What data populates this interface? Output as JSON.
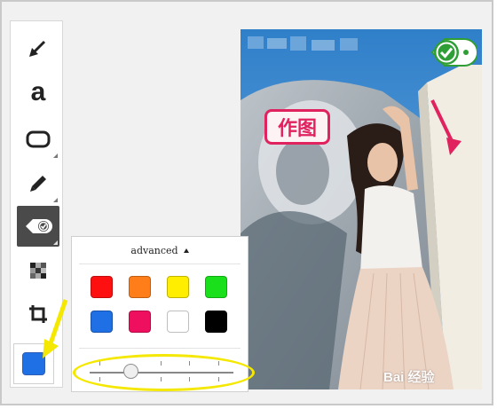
{
  "annotation_label": "作图",
  "watermark": "Bai 经验",
  "toolbar": {
    "tools": [
      {
        "name": "arrow-tool",
        "icon": "arrow-icon",
        "active": false
      },
      {
        "name": "text-tool",
        "icon": "text-a-icon",
        "glyph": "a",
        "active": false
      },
      {
        "name": "shape-tool",
        "icon": "rounded-rect-icon",
        "active": false
      },
      {
        "name": "pen-tool",
        "icon": "pen-icon",
        "active": false
      },
      {
        "name": "stamp-tool",
        "icon": "check-stamp-icon",
        "active": true
      },
      {
        "name": "mosaic-tool",
        "icon": "mosaic-icon",
        "active": false
      },
      {
        "name": "crop-tool",
        "icon": "crop-icon",
        "active": false
      }
    ],
    "current_color": "#1f6fe5"
  },
  "color_popup": {
    "header_label": "advanced",
    "colors": [
      "#ff1010",
      "#ff7e1a",
      "#ffee00",
      "#19e01a",
      "#1f6fe5",
      "#ef0f5f",
      "#ffffff",
      "#000000"
    ],
    "size_level": 0.25
  },
  "highlight_color": "#f5e800",
  "accent_pink": "#e0235f"
}
